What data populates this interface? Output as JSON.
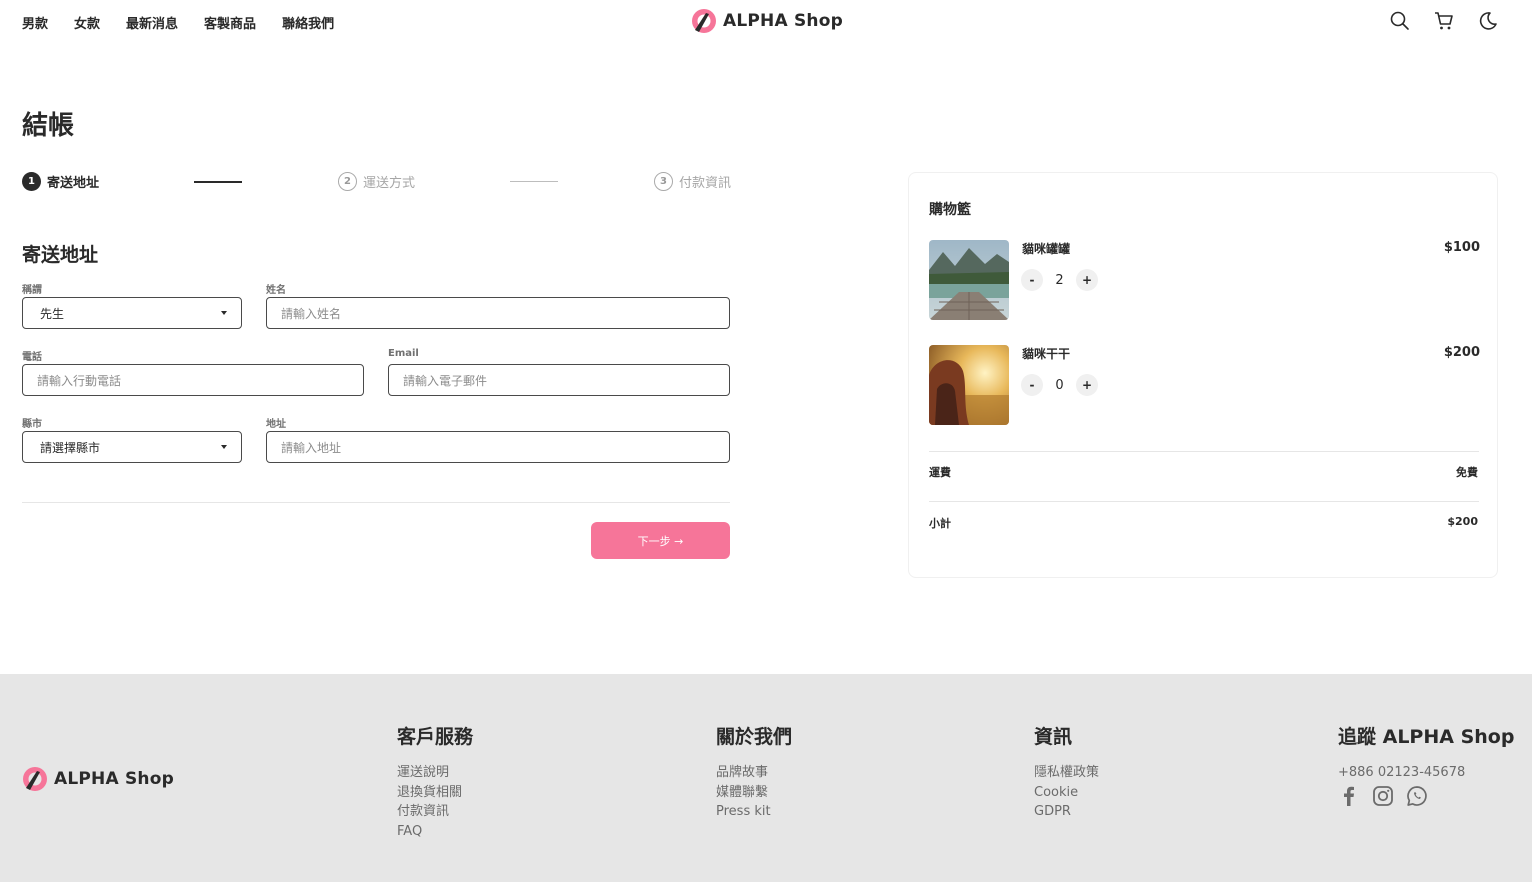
{
  "header": {
    "nav": [
      "男款",
      "女款",
      "最新消息",
      "客製商品",
      "聯絡我們"
    ],
    "logo_text": "ALPHA Shop",
    "icons": [
      "search-icon",
      "cart-icon",
      "moon-icon"
    ]
  },
  "checkout": {
    "title": "結帳",
    "steps": [
      {
        "number": "1",
        "label": "寄送地址",
        "state": "active"
      },
      {
        "number": "2",
        "label": "運送方式",
        "state": "inactive"
      },
      {
        "number": "3",
        "label": "付款資訊",
        "state": "inactive"
      }
    ],
    "form_title": "寄送地址",
    "fields": {
      "salutation": {
        "label": "稱謂",
        "value": "先生"
      },
      "name": {
        "label": "姓名",
        "placeholder": "請輸入姓名"
      },
      "phone": {
        "label": "電話",
        "placeholder": "請輸入行動電話"
      },
      "email": {
        "label": "Email",
        "placeholder": "請輸入電子郵件"
      },
      "city": {
        "label": "縣市",
        "value": "請選擇縣市"
      },
      "address": {
        "label": "地址",
        "placeholder": "請輸入地址"
      }
    },
    "next_button": "下一步 →"
  },
  "cart": {
    "title": "購物籃",
    "items": [
      {
        "name": "貓咪罐罐",
        "price": "$100",
        "qty": "2"
      },
      {
        "name": "貓咪干干",
        "price": "$200",
        "qty": "0"
      }
    ],
    "shipping_label": "運費",
    "shipping_value": "免費",
    "subtotal_label": "小計",
    "subtotal_value": "$200",
    "minus": "-",
    "plus": "+"
  },
  "footer": {
    "logo_text": "ALPHA Shop",
    "customer_service": {
      "title": "客戶服務",
      "links": [
        "運送說明",
        "退換貨相關",
        "付款資訊",
        "FAQ"
      ]
    },
    "about": {
      "title": "關於我們",
      "links": [
        "品牌故事",
        "媒體聯繫",
        "Press kit"
      ]
    },
    "info": {
      "title": "資訊",
      "links": [
        "隱私權政策",
        "Cookie",
        "GDPR"
      ]
    },
    "follow": {
      "title": "追蹤 ALPHA Shop",
      "phone": "+886 02123-45678",
      "icons": [
        "facebook-icon",
        "instagram-icon",
        "whatsapp-icon"
      ]
    }
  },
  "colors": {
    "accent": "#f67599",
    "text": "#2a2a2a",
    "footer_bg": "#e6e6e6"
  }
}
